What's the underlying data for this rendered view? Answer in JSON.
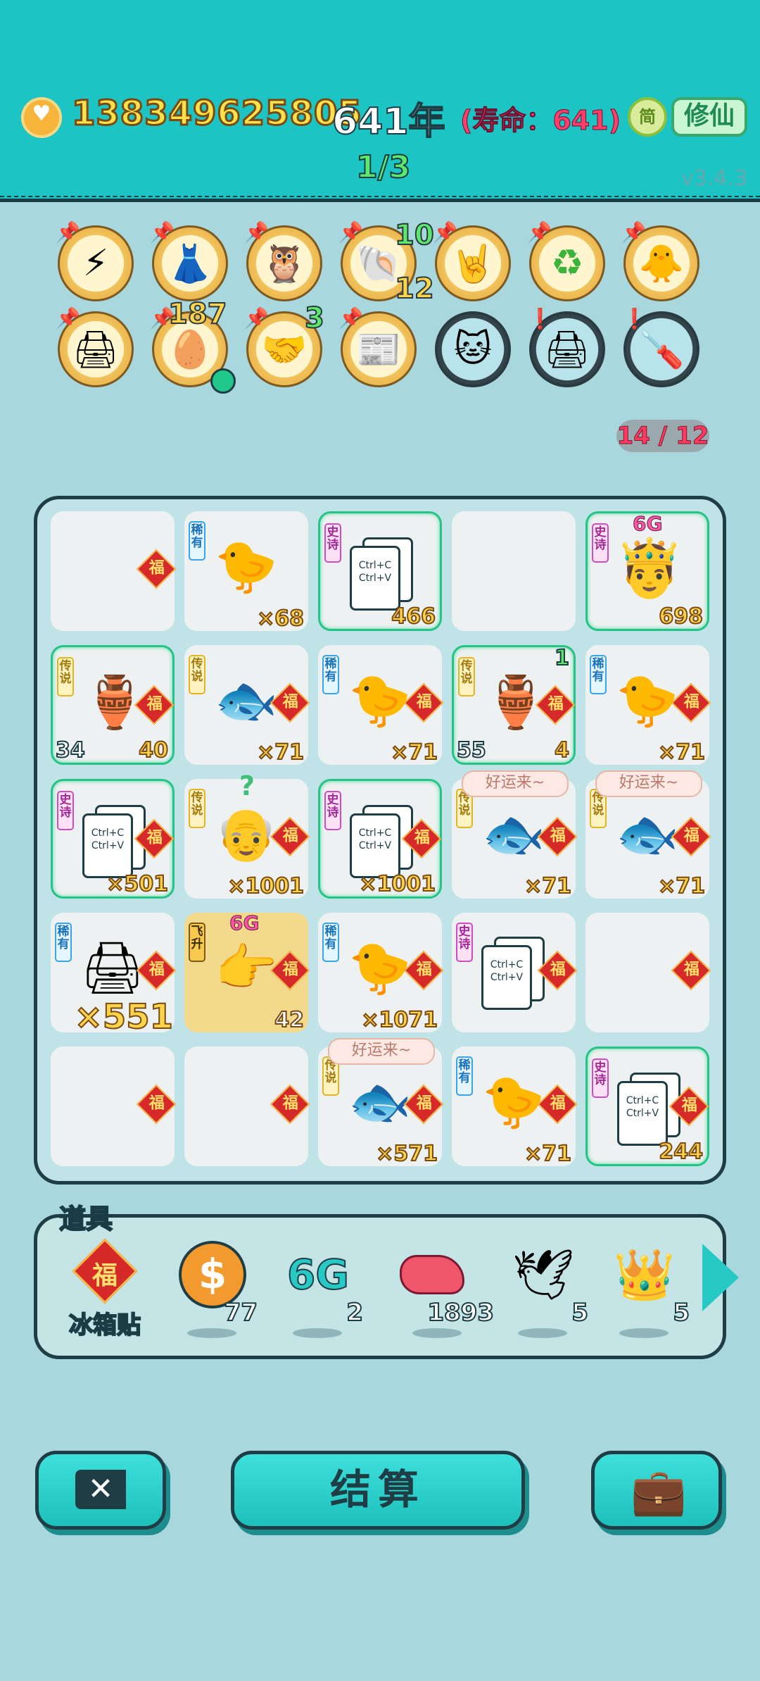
{
  "header": {
    "money": "138349625805",
    "year": "641年",
    "lifespan": "(寿命：641)",
    "simplified_label": "简",
    "xiuxian_label": "修仙",
    "page_indicator": "1/3",
    "version": "v3.4.3"
  },
  "buffs": [
    {
      "icon": "lightning-icon",
      "glyph": "⚡",
      "count": ""
    },
    {
      "icon": "skirt-icon",
      "glyph": "👗",
      "count": ""
    },
    {
      "icon": "owl-glasses-icon",
      "glyph": "🦉",
      "count": ""
    },
    {
      "icon": "shell-icon",
      "glyph": "🐚",
      "count": "10",
      "count2": "12"
    },
    {
      "icon": "rock-hand-icon",
      "glyph": "🤘",
      "count": ""
    },
    {
      "icon": "recycle-icon",
      "glyph": "♻",
      "count": ""
    },
    {
      "icon": "chick-egg-icon",
      "glyph": "🐥",
      "count": ""
    },
    {
      "icon": "printer-warning-icon",
      "glyph": "🖨",
      "count": ""
    },
    {
      "icon": "egg-tray-icon",
      "glyph": "🥚",
      "count": "187"
    },
    {
      "icon": "handshake-icon",
      "glyph": "🤝",
      "count": "3"
    },
    {
      "icon": "time-magazine-icon",
      "glyph": "📰",
      "count": ""
    },
    {
      "icon": "cat-icon",
      "glyph": "🐱",
      "count": ""
    },
    {
      "icon": "printer-warning-icon",
      "glyph": "🖨",
      "count": ""
    },
    {
      "icon": "screwdriver-icon",
      "glyph": "🪛",
      "count": ""
    }
  ],
  "slots_counter": "14 / 12",
  "fu_label": "福",
  "rarity_labels": {
    "rare": "稀有",
    "epic": "史诗",
    "legend": "传说",
    "ascend": "飞升"
  },
  "bubble_text": "好运来~",
  "copy_paste": {
    "line1": "Ctrl+C",
    "line2": "Ctrl+V"
  },
  "sixg_label": "6G",
  "question_mark": "?",
  "grid": [
    {
      "rarity": "",
      "counts": {
        "right": ""
      }
    },
    {
      "rarity": "rare",
      "item": "chick",
      "counts": {
        "right": "×68"
      }
    },
    {
      "rarity": "epic",
      "item": "copy",
      "counts": {
        "right": "466"
      }
    },
    {
      "rarity": "",
      "counts": {
        "right": ""
      }
    },
    {
      "rarity": "epic",
      "item": "king",
      "counts": {
        "right": "698"
      }
    },
    {
      "rarity": "legend",
      "item": "vase",
      "counts": {
        "left": "34",
        "right": "40"
      }
    },
    {
      "rarity": "legend",
      "item": "koi",
      "counts": {
        "right": "×71"
      }
    },
    {
      "rarity": "rare",
      "item": "chick",
      "counts": {
        "right": "×71"
      }
    },
    {
      "rarity": "legend",
      "item": "vase",
      "counts": {
        "left": "55",
        "right": "4",
        "top": "1"
      }
    },
    {
      "rarity": "rare",
      "item": "chick",
      "counts": {
        "right": "×71"
      }
    },
    {
      "rarity": "epic",
      "item": "copy",
      "counts": {
        "right": "×501"
      }
    },
    {
      "rarity": "legend",
      "item": "oldman",
      "counts": {
        "right": "×1001"
      }
    },
    {
      "rarity": "epic",
      "item": "copy",
      "counts": {
        "right": "×1001"
      }
    },
    {
      "rarity": "legend",
      "item": "koi",
      "counts": {
        "right": "×71"
      }
    },
    {
      "rarity": "legend",
      "item": "koi",
      "counts": {
        "right": "×71"
      }
    },
    {
      "rarity": "rare",
      "item": "printer",
      "counts": {
        "right": "×551"
      }
    },
    {
      "rarity": "ascend",
      "item": "hand",
      "counts": {
        "right": "42"
      }
    },
    {
      "rarity": "rare",
      "item": "chick",
      "counts": {
        "right": "×1071"
      }
    },
    {
      "rarity": "epic",
      "item": "copy",
      "counts": {
        "right": ""
      }
    },
    {
      "rarity": "",
      "counts": {
        "right": ""
      }
    },
    {
      "rarity": "",
      "counts": {
        "right": ""
      }
    },
    {
      "rarity": "",
      "counts": {
        "right": ""
      }
    },
    {
      "rarity": "legend",
      "item": "koi",
      "counts": {
        "right": "×571"
      }
    },
    {
      "rarity": "rare",
      "item": "chick",
      "counts": {
        "right": "×71"
      }
    },
    {
      "rarity": "epic",
      "item": "copy",
      "counts": {
        "right": "244"
      }
    }
  ],
  "tools": {
    "title": "道具",
    "items": [
      {
        "name": "冰箱贴",
        "icon": "fridge-magnet-icon",
        "count": ""
      },
      {
        "icon": "dollar-coin-icon",
        "count": "77"
      },
      {
        "icon": "6g-icon",
        "count": "2"
      },
      {
        "icon": "liver-icon",
        "count": "1893"
      },
      {
        "icon": "pigeon-icon",
        "count": "5"
      },
      {
        "icon": "crown-icon",
        "count": "5"
      }
    ]
  },
  "buttons": {
    "settle": "结算"
  },
  "colors": {
    "header_bg": "#1cc4c3",
    "page_bg": "#a9d7de",
    "epic_border": "#25c385"
  }
}
